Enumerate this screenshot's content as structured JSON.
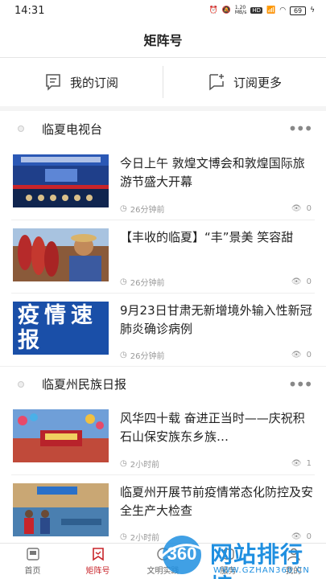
{
  "status": {
    "time": "14:31",
    "net_speed": "1.20\nMB/s",
    "battery": "69"
  },
  "header": {
    "title": "矩阵号"
  },
  "subscriptions": {
    "mine_label": "我的订阅",
    "more_label": "订阅更多"
  },
  "channels": [
    {
      "name": "临夏电视台",
      "items": [
        {
          "title": "今日上午 敦煌文博会和敦煌国际旅游节盛大开幕",
          "time": "26分钟前",
          "views": "0"
        },
        {
          "title": "【丰收的临夏】“丰”景美 笑容甜",
          "time": "26分钟前",
          "views": "0"
        },
        {
          "title": "9月23日甘肃无新增境外输入性新冠肺炎确诊病例",
          "time": "26分钟前",
          "views": "0",
          "thumb_text": "疫情速报"
        }
      ]
    },
    {
      "name": "临夏州民族日报",
      "items": [
        {
          "title": "风华四十载 奋进正当时——庆祝积石山保安族东乡族…",
          "time": "2小时前",
          "views": "1"
        },
        {
          "title": "临夏州开展节前疫情常态化防控及安全生产大检查",
          "time": "2小时前",
          "views": "0"
        }
      ]
    }
  ],
  "tabs": [
    {
      "label": "首页"
    },
    {
      "label": "矩阵号"
    },
    {
      "label": "文明实践"
    },
    {
      "label": "服务"
    },
    {
      "label": "我的"
    }
  ],
  "watermark": {
    "logo_text": "360",
    "title": "网站排行榜",
    "url": "WWW.GZHAN360.CN"
  },
  "colors": {
    "accent": "#c8242a"
  }
}
